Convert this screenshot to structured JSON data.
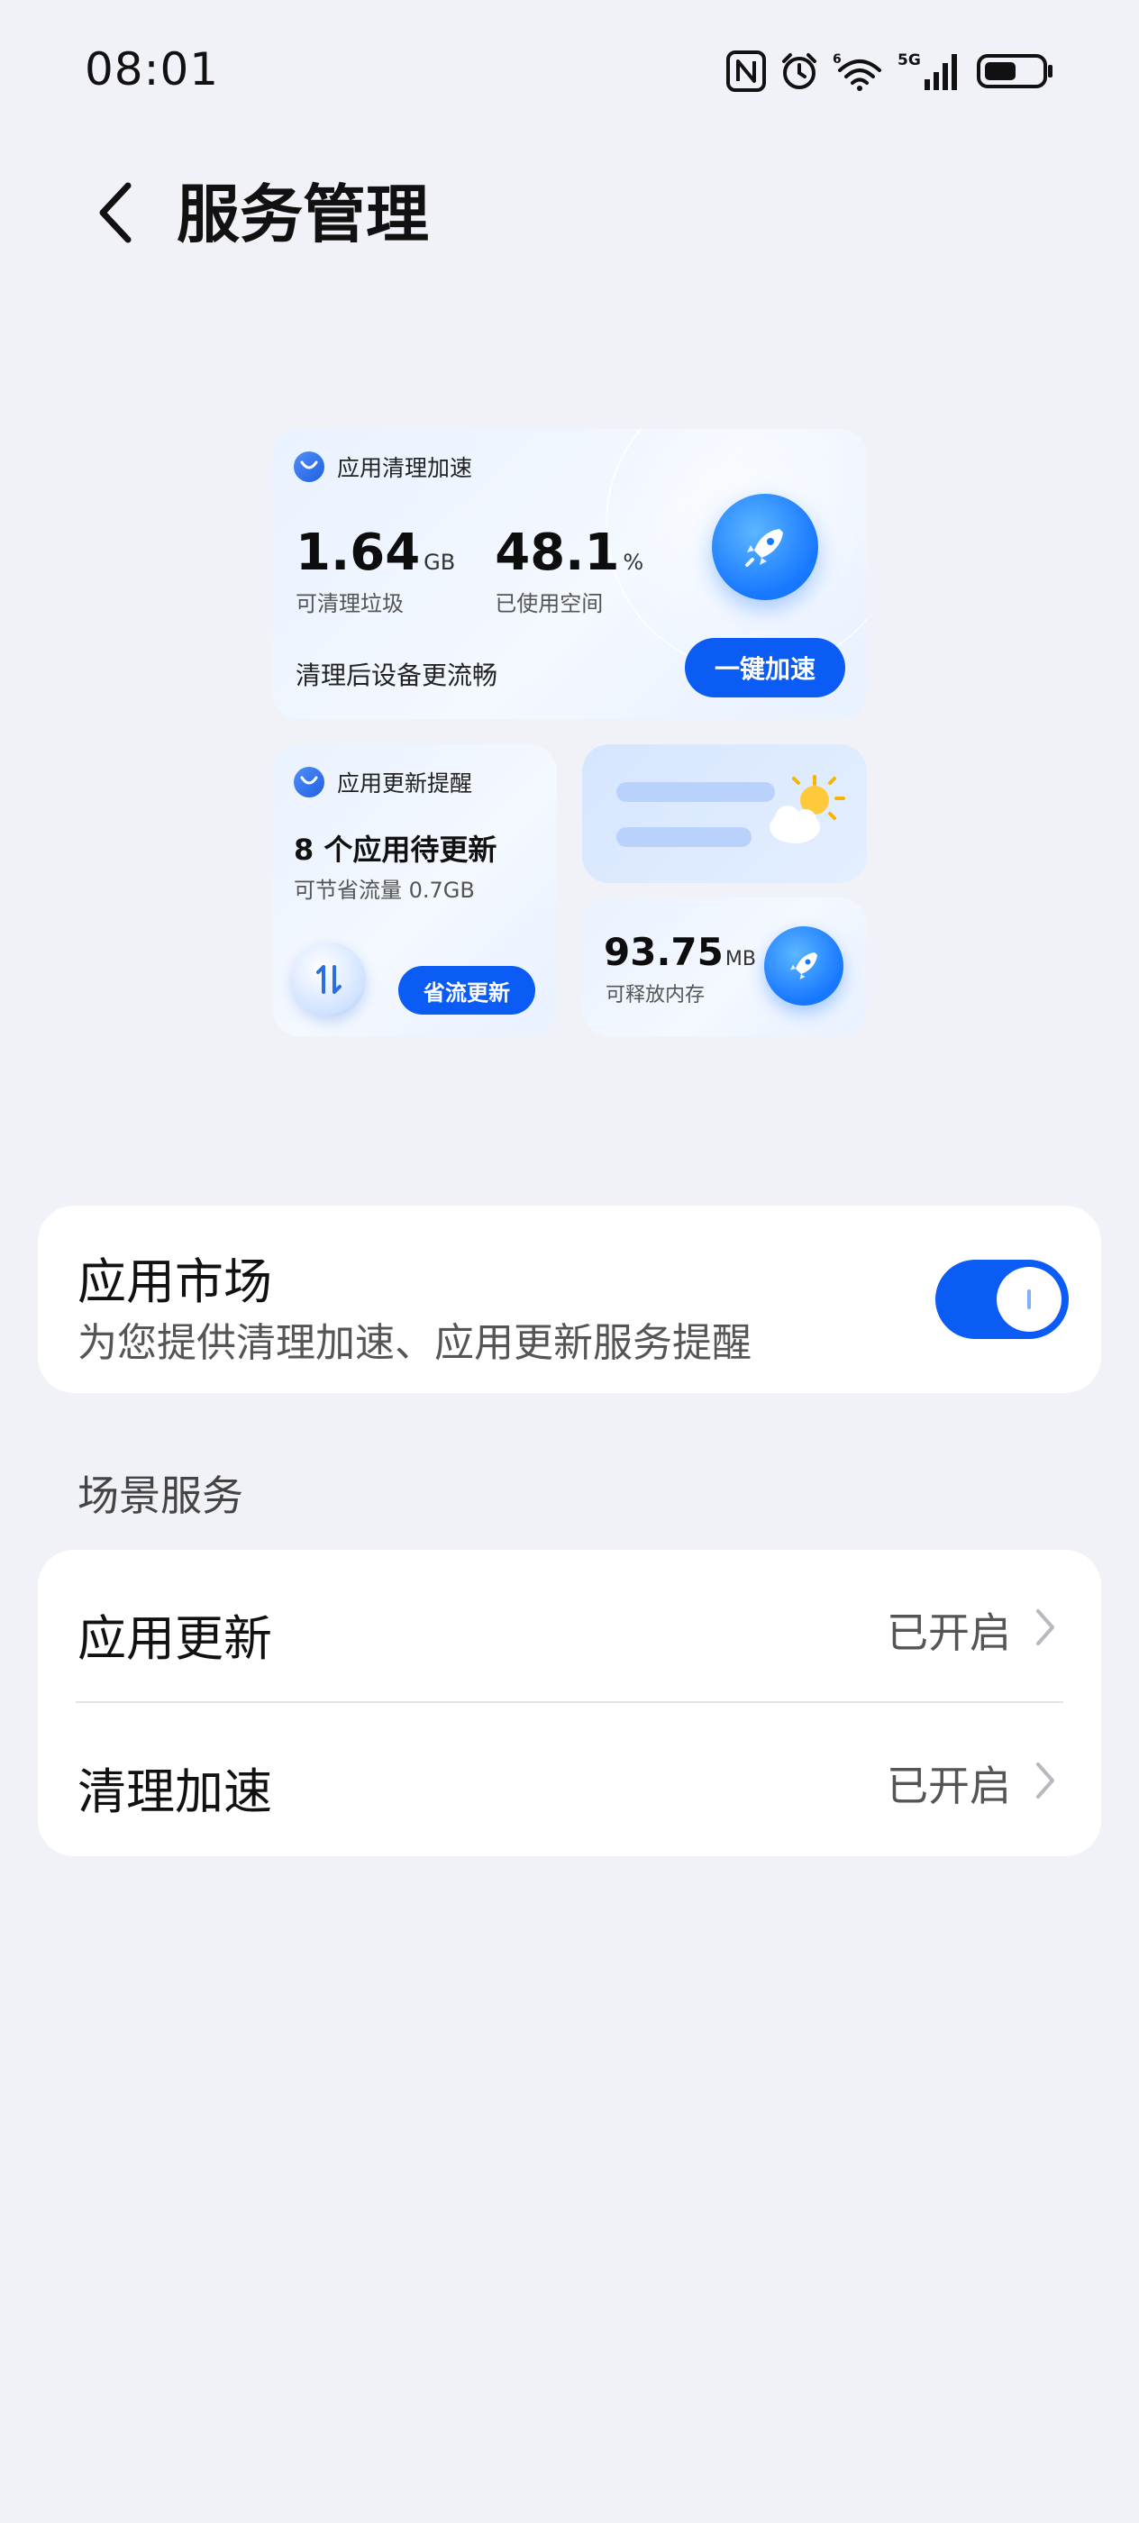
{
  "status_bar": {
    "time": "08:01",
    "icons": [
      "nfc-icon",
      "alarm-icon",
      "wifi-icon",
      "signal-5g-icon",
      "battery-icon"
    ]
  },
  "header": {
    "title": "服务管理",
    "back_icon": "chevron-left-icon"
  },
  "widget_preview": {
    "clean_card": {
      "title": "应用清理加速",
      "junk_value": "1.64",
      "junk_unit": "GB",
      "junk_label": "可清理垃圾",
      "used_value": "48.1",
      "used_unit": "%",
      "used_label": "已使用空间",
      "tip": "清理后设备更流畅",
      "button": "一键加速"
    },
    "update_card": {
      "title": "应用更新提醒",
      "count_text": "8 个应用待更新",
      "save_text": "可节省流量 0.7GB",
      "button": "省流更新"
    },
    "memory_card": {
      "value": "93.75",
      "unit": "MB",
      "label": "可释放内存"
    }
  },
  "app_market": {
    "title": "应用市场",
    "description": "为您提供清理加速、应用更新服务提醒",
    "toggle_on": true
  },
  "scene_services": {
    "section_label": "场景服务",
    "items": [
      {
        "label": "应用更新",
        "status": "已开启"
      },
      {
        "label": "清理加速",
        "status": "已开启"
      }
    ]
  },
  "colors": {
    "accent": "#0a5cf5",
    "background": "#f1f2f7",
    "card": "#ffffff"
  }
}
